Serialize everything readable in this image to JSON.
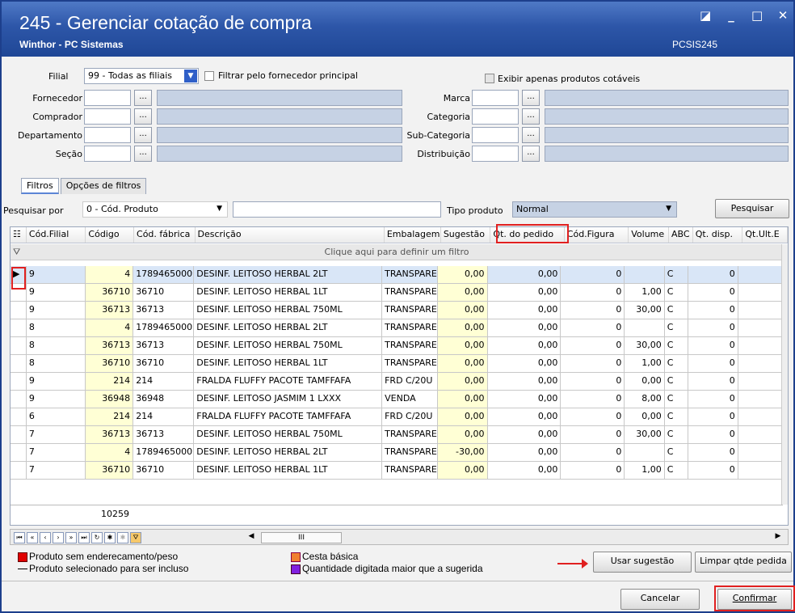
{
  "window": {
    "title": "245 - Gerenciar cotação de compra",
    "subtitle": "Winthor - PC Sistemas",
    "code": "PCSIS245",
    "btn_min": "_",
    "btn_close": "✕",
    "btn_max": "□",
    "btn_restore": "◪"
  },
  "filters": {
    "filial_label": "Filial",
    "filial_value": "99 - Todas as filiais",
    "filtrar_fornecedor": "Filtrar pelo fornecedor principal",
    "exibir_cotaveis": "Exibir apenas produtos cotáveis",
    "fornecedor": "Fornecedor",
    "comprador": "Comprador",
    "departamento": "Departamento",
    "secao": "Seção",
    "marca": "Marca",
    "categoria": "Categoria",
    "subcategoria": "Sub-Categoria",
    "distribuicao": "Distribuição",
    "dots": "..."
  },
  "tabs": [
    "Filtros",
    "Opções de filtros"
  ],
  "search": {
    "label": "Pesquisar por",
    "value": "0 - Cód. Produto",
    "tipo_label": "Tipo produto",
    "tipo_value": "Normal",
    "button": "Pesquisar"
  },
  "grid": {
    "columns": [
      "Cód.Filial",
      "Código",
      "Cód. fábrica",
      "Descrição",
      "Embalagem",
      "Sugestão",
      "Qt. do pedido",
      "Cód.Figura",
      "Volume",
      "ABC",
      "Qt. disp.",
      "Qt.Ult.E"
    ],
    "filter_hint": "Clique aqui para definir um filtro",
    "rows": [
      [
        "9",
        "4",
        "1789465000",
        "DESINF. LEITOSO HERBAL 2LT",
        "TRANSPARE",
        "0,00",
        "0,00",
        "0",
        "",
        "C",
        "0"
      ],
      [
        "9",
        "36710",
        "36710",
        "DESINF. LEITOSO HERBAL 1LT",
        "TRANSPARE",
        "0,00",
        "0,00",
        "0",
        "1,00",
        "C",
        "0"
      ],
      [
        "9",
        "36713",
        "36713",
        "DESINF. LEITOSO HERBAL 750ML",
        "TRANSPARE",
        "0,00",
        "0,00",
        "0",
        "30,00",
        "C",
        "0"
      ],
      [
        "8",
        "4",
        "1789465000",
        "DESINF. LEITOSO HERBAL 2LT",
        "TRANSPARE",
        "0,00",
        "0,00",
        "0",
        "",
        "C",
        "0"
      ],
      [
        "8",
        "36713",
        "36713",
        "DESINF. LEITOSO HERBAL 750ML",
        "TRANSPARE",
        "0,00",
        "0,00",
        "0",
        "30,00",
        "C",
        "0"
      ],
      [
        "8",
        "36710",
        "36710",
        "DESINF. LEITOSO HERBAL 1LT",
        "TRANSPARE",
        "0,00",
        "0,00",
        "0",
        "1,00",
        "C",
        "0"
      ],
      [
        "9",
        "214",
        "214",
        "FRALDA FLUFFY PACOTE TAMFFAFA",
        "FRD C/20U",
        "0,00",
        "0,00",
        "0",
        "0,00",
        "C",
        "0"
      ],
      [
        "9",
        "36948",
        "36948",
        "DESINF. LEITOSO JASMIM 1 LXXX",
        "VENDA",
        "0,00",
        "0,00",
        "0",
        "8,00",
        "C",
        "0"
      ],
      [
        "6",
        "214",
        "214",
        "FRALDA FLUFFY PACOTE TAMFFAFA",
        "FRD C/20U",
        "0,00",
        "0,00",
        "0",
        "0,00",
        "C",
        "0"
      ],
      [
        "7",
        "36713",
        "36713",
        "DESINF. LEITOSO HERBAL 750ML",
        "TRANSPARE",
        "0,00",
        "0,00",
        "0",
        "30,00",
        "C",
        "0"
      ],
      [
        "7",
        "4",
        "1789465000",
        "DESINF. LEITOSO HERBAL 2LT",
        "TRANSPARE",
        "-30,00",
        "0,00",
        "0",
        "",
        "C",
        "0"
      ],
      [
        "7",
        "36710",
        "36710",
        "DESINF. LEITOSO HERBAL 1LT",
        "TRANSPARE",
        "0,00",
        "0,00",
        "0",
        "1,00",
        "C",
        "0"
      ]
    ],
    "total": "10259",
    "hscroll_mark": "III"
  },
  "legend": {
    "sem_endereco": "Produto sem enderecamento/peso",
    "selecionado": "Produto selecionado para ser incluso",
    "cesta": "Cesta básica",
    "qtd_maior": "Quantidade digitada maior que a sugerida"
  },
  "buttons": {
    "usar_sugestao": "Usar sugestão",
    "limpar": "Limpar qtde pedida",
    "cancelar": "Cancelar",
    "confirmar": "Confirmar"
  },
  "colors": {
    "red": "#e00000",
    "orange": "#f08030",
    "purple": "#8020e0"
  }
}
